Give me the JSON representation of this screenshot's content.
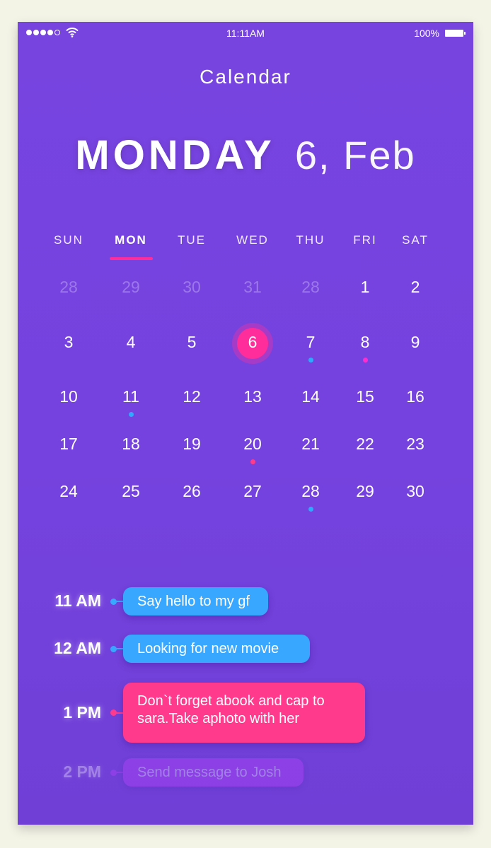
{
  "status_bar": {
    "signal_bars": 5,
    "signal_filled": 4,
    "wifi_icon": "wifi-icon",
    "time": "11:11AM",
    "battery_percent": "100%",
    "battery_icon": "battery-full-icon"
  },
  "header": {
    "title": "Calendar",
    "day_name": "MONDAY",
    "date": "6, Feb"
  },
  "calendar": {
    "weekdays": [
      "SUN",
      "MON",
      "TUE",
      "WED",
      "THU",
      "FRI",
      "SAT"
    ],
    "active_weekday_index": 1,
    "weeks": [
      [
        {
          "d": "28",
          "muted": true
        },
        {
          "d": "29",
          "muted": true
        },
        {
          "d": "30",
          "muted": true
        },
        {
          "d": "31",
          "muted": true
        },
        {
          "d": "28",
          "muted": true
        },
        {
          "d": "1"
        },
        {
          "d": "2"
        }
      ],
      [
        {
          "d": "3"
        },
        {
          "d": "4"
        },
        {
          "d": "5"
        },
        {
          "d": "6",
          "today": true
        },
        {
          "d": "7",
          "dot": "#2fa8ff"
        },
        {
          "d": "8",
          "dot": "#ff2dd0"
        },
        {
          "d": "9"
        }
      ],
      [
        {
          "d": "10"
        },
        {
          "d": "11",
          "dot": "#2fa8ff"
        },
        {
          "d": "12"
        },
        {
          "d": "13"
        },
        {
          "d": "14"
        },
        {
          "d": "15"
        },
        {
          "d": "16"
        }
      ],
      [
        {
          "d": "17"
        },
        {
          "d": "18"
        },
        {
          "d": "19"
        },
        {
          "d": "20",
          "dot": "#ff3b8a"
        },
        {
          "d": "21"
        },
        {
          "d": "22"
        },
        {
          "d": "23"
        }
      ],
      [
        {
          "d": "24"
        },
        {
          "d": "25"
        },
        {
          "d": "26"
        },
        {
          "d": "27"
        },
        {
          "d": "28",
          "dot": "#2fa8ff"
        },
        {
          "d": "29"
        },
        {
          "d": "30"
        }
      ]
    ]
  },
  "agenda": [
    {
      "time": "11 AM",
      "text": "Say hello to my gf",
      "color": "#38a7ff"
    },
    {
      "time": "12 AM",
      "text": "Looking for new movie",
      "color": "#38a7ff"
    },
    {
      "time": "1 PM",
      "text": "Don`t forget abook and cap to sara.Take aphoto with her",
      "color": "#ff3a8c"
    },
    {
      "time": "2 PM",
      "text": "Send message to Josh",
      "color": "#c040ff",
      "faded": true
    }
  ],
  "colors": {
    "background": "#7542df",
    "accent_pink": "#ff2d9b",
    "event_blue": "#38a7ff",
    "event_pink": "#ff3a8c",
    "page_bg": "#f3f3e6"
  }
}
